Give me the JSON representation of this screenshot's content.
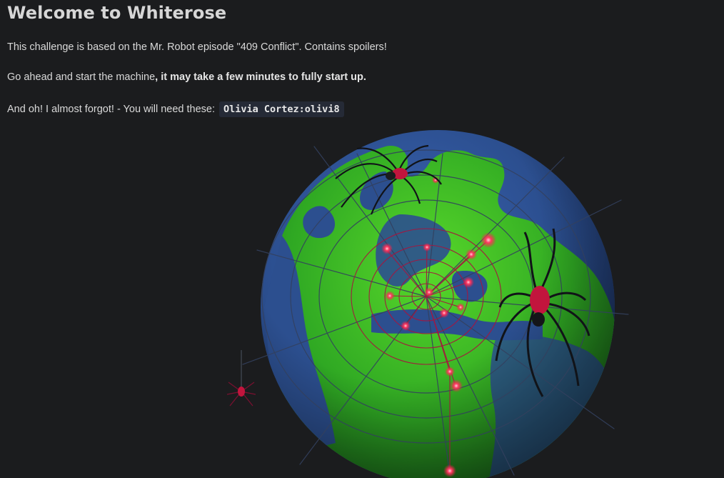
{
  "page": {
    "title": "Welcome to Whiterose",
    "intro": "This challenge is based on the Mr. Robot episode \"409 Conflict\". Contains spoilers!",
    "start_text": "Go ahead and start the machine",
    "start_bold": ", it may take a few minutes to fully start up.",
    "creds_text": "And oh! I almost forgot! - You will need these:",
    "creds_code": "Olivia Cortez:olivi8"
  },
  "colors": {
    "background": "#1b1c1e",
    "ocean": "#2c4f8f",
    "land": "#3fb424",
    "web_red": "#c2153d",
    "web_dark": "#33405e",
    "code_bg": "#252a36"
  },
  "illustration": {
    "subject": "globe-with-spider-web",
    "icons": [
      "globe-icon",
      "spider-icon",
      "spider-web-icon",
      "glowing-node-icon"
    ]
  }
}
